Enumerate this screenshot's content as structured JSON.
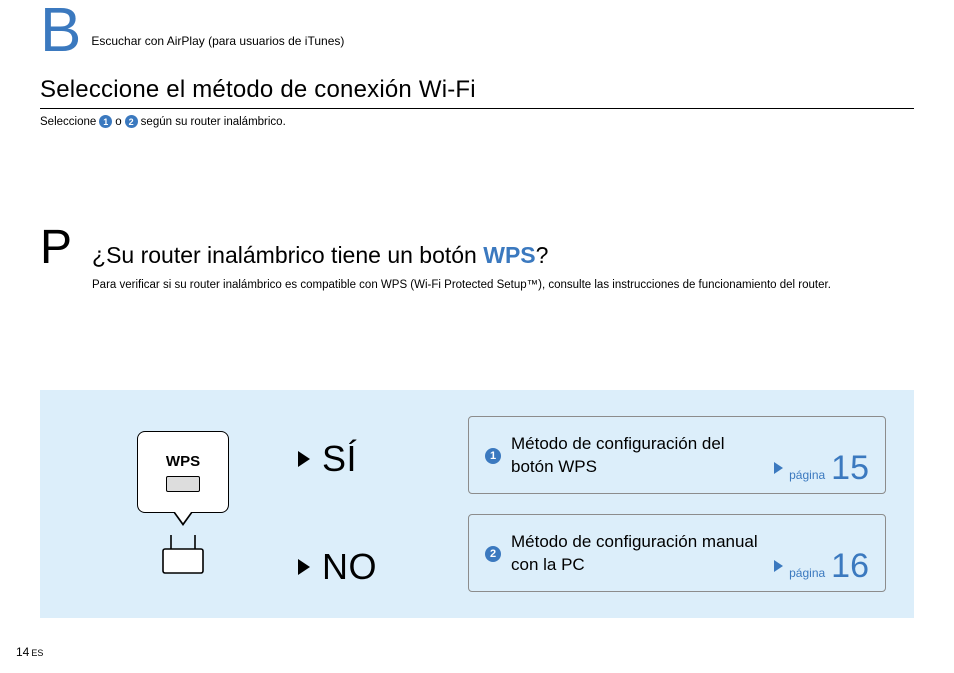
{
  "header": {
    "letter": "B",
    "subtitle": "Escuchar con AirPlay (para usuarios de iTunes)"
  },
  "title": "Seleccione el método de conexión Wi-Fi",
  "instruction": {
    "pre": "Seleccione",
    "mid": "o",
    "post": "según su router inalámbrico."
  },
  "question": {
    "letter": "P",
    "text_pre": "¿Su router inalámbrico tiene un botón ",
    "wps": "WPS",
    "text_post": "?",
    "note": "Para verificar si su router inalámbrico es compatible con WPS (Wi-Fi Protected Setup™), consulte las instrucciones de funcionamiento del router."
  },
  "diagram": {
    "wps_label": "WPS"
  },
  "yes_no": {
    "yes": "SÍ",
    "no": "NO"
  },
  "options": [
    {
      "num": "1",
      "text": "Método de configuración del botón WPS",
      "page_label": "página",
      "page_num": "15"
    },
    {
      "num": "2",
      "text": "Método de configuración manual con la PC",
      "page_label": "página",
      "page_num": "16"
    }
  ],
  "footer": {
    "page": "14",
    "lang": "ES"
  }
}
